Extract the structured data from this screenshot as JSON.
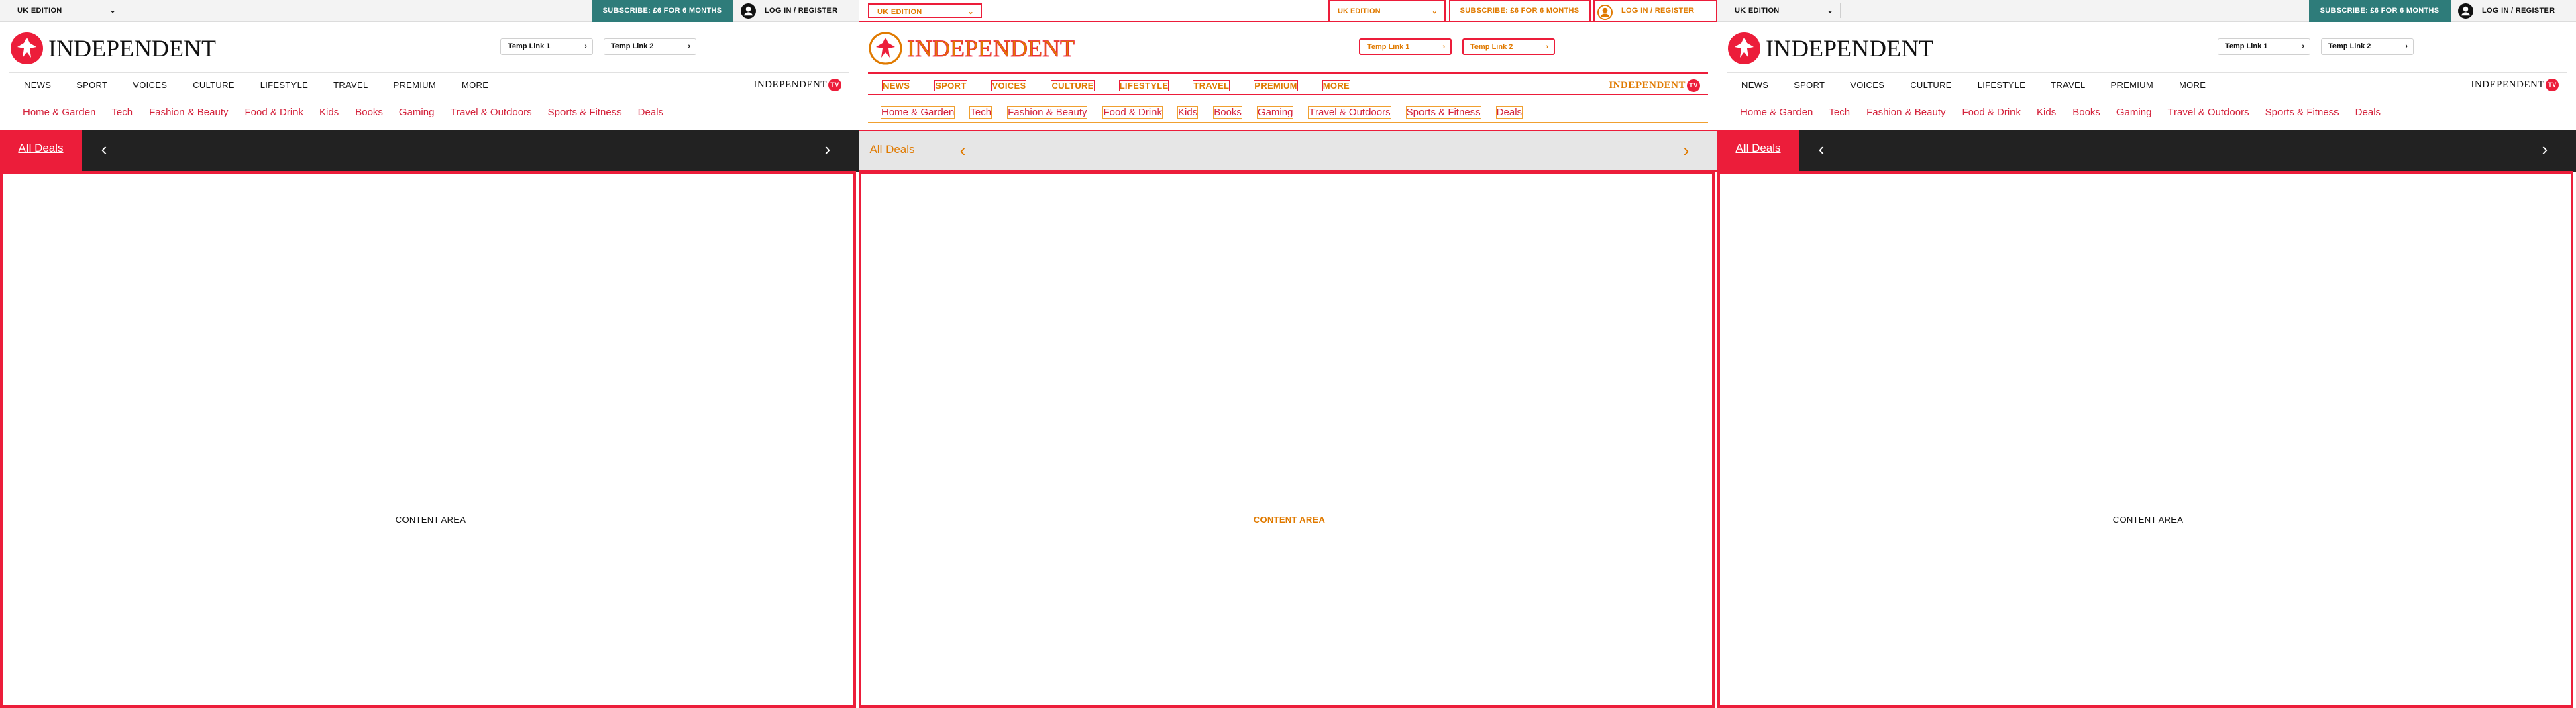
{
  "topbar": {
    "edition": "UK EDITION",
    "subscribe": "SUBSCRIBE: £6 FOR 6 MONTHS",
    "login": "LOG IN / REGISTER"
  },
  "logo": {
    "text": "INDEPENDENT"
  },
  "temp_links": [
    "Temp Link 1",
    "Temp Link 2"
  ],
  "main_nav": [
    "NEWS",
    "SPORT",
    "VOICES",
    "CULTURE",
    "LIFESTYLE",
    "TRAVEL",
    "PREMIUM",
    "MORE"
  ],
  "tv_logo": {
    "text": "INDEPENDENT",
    "badge": "TV"
  },
  "deals_nav": [
    "Home & Garden",
    "Tech",
    "Fashion & Beauty",
    "Food & Drink",
    "Kids",
    "Books",
    "Gaming",
    "Travel & Outdoors",
    "Sports & Fitness",
    "Deals"
  ],
  "carousel": {
    "all_deals": "All Deals",
    "prev": "‹",
    "next": "›"
  },
  "content": {
    "label": "CONTENT AREA"
  },
  "colors": {
    "brand_red": "#ec1d3a",
    "subscribe_teal": "#2e7c7a",
    "deal_link": "#d4233c",
    "carousel_bg": "#222222"
  }
}
